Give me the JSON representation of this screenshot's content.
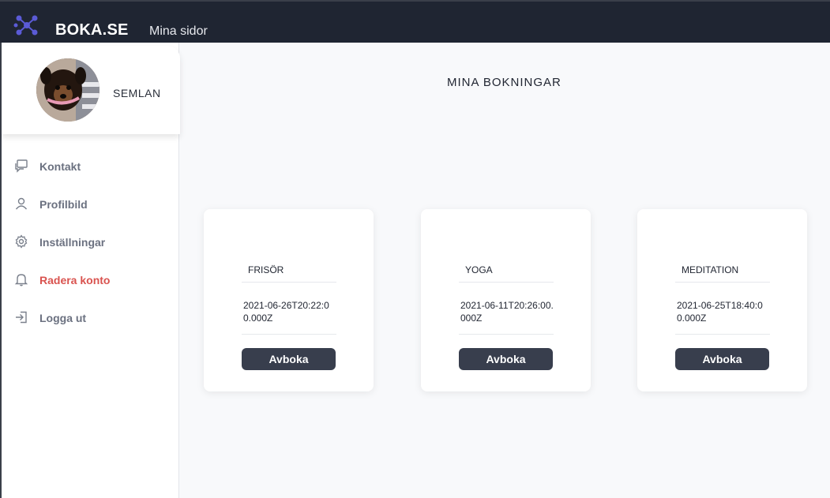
{
  "header": {
    "brand": "BOKA.SE",
    "nav_link": "Mina sidor",
    "logo_icon": "molecule-logo-icon",
    "accent_color": "#5b5bd6",
    "background_color": "#1f2532"
  },
  "sidebar": {
    "username": "SEMLAN",
    "avatar_icon": "profile-photo",
    "items": [
      {
        "label": "Kontakt",
        "icon": "chat-icon"
      },
      {
        "label": "Profilbild",
        "icon": "user-icon"
      },
      {
        "label": "Inställningar",
        "icon": "gear-icon"
      },
      {
        "label": "Radera konto",
        "icon": "bell-icon",
        "color": "#d9534f"
      },
      {
        "label": "Logga ut",
        "icon": "logout-icon"
      }
    ]
  },
  "main": {
    "title": "MINA BOKNINGAR",
    "bookings": [
      {
        "service": "FRISÖR",
        "datetime": "2021-06-26T20:22:00.000Z",
        "button": "Avboka"
      },
      {
        "service": "YOGA",
        "datetime": "2021-06-11T20:26:00.000Z",
        "button": "Avboka"
      },
      {
        "service": "MEDITATION",
        "datetime": "2021-06-25T18:40:00.000Z",
        "button": "Avboka"
      }
    ]
  }
}
